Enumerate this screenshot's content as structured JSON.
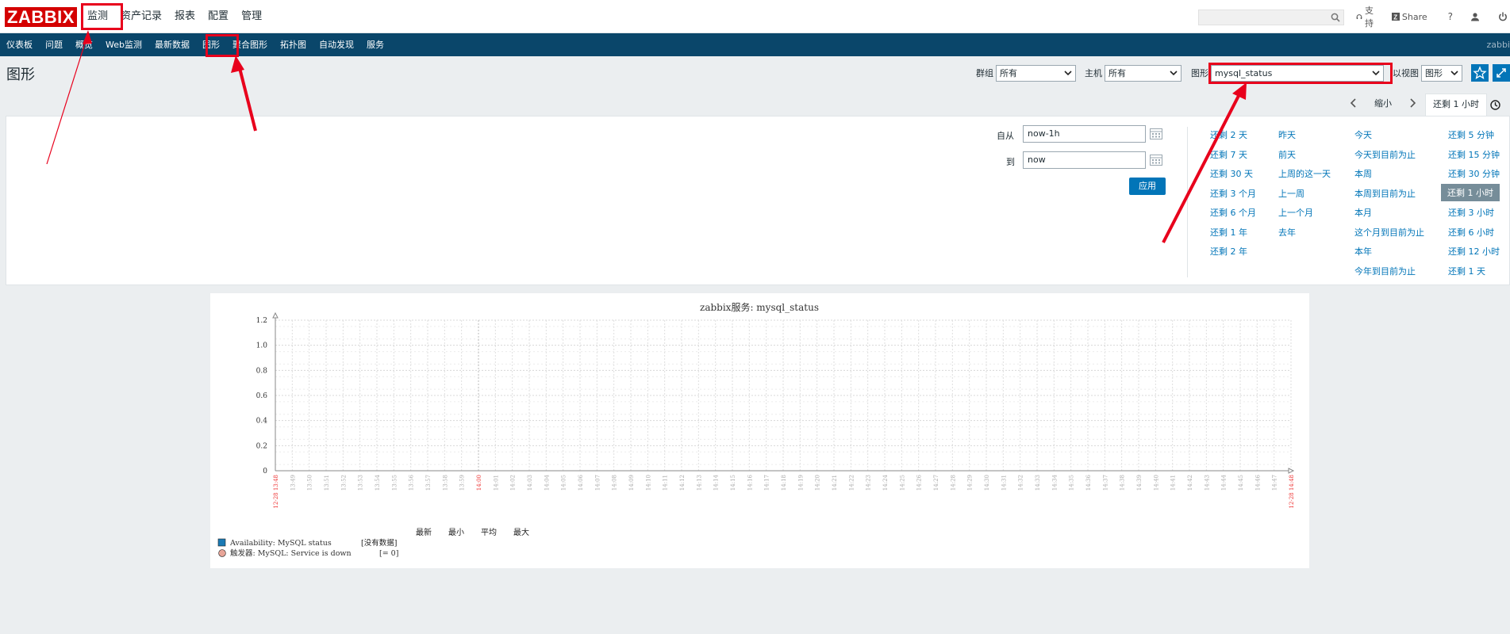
{
  "topbar": {
    "logo": "ZABBIX",
    "menu": [
      "监测",
      "资产记录",
      "报表",
      "配置",
      "管理"
    ],
    "support": "支持",
    "share": "Share",
    "help": "?"
  },
  "subnav": {
    "items": [
      "仪表板",
      "问题",
      "概览",
      "Web监测",
      "最新数据",
      "图形",
      "聚合图形",
      "拓扑图",
      "自动发现",
      "服务"
    ],
    "brand": "zabbi"
  },
  "header": {
    "title": "图形",
    "group_label": "群组",
    "group_value": "所有",
    "host_label": "主机",
    "host_value": "所有",
    "graph_label": "图形",
    "graph_value": "mysql_status",
    "view_label": "以视图",
    "view_value": "图形"
  },
  "tabs": {
    "zoom_out": "缩小",
    "active": "还剩 1 小时"
  },
  "time_filter": {
    "from_label": "自从",
    "from_value": "now-1h",
    "to_label": "到",
    "to_value": "now",
    "apply": "应用",
    "col1": [
      "还剩 2 天",
      "还剩 7 天",
      "还剩 30 天",
      "还剩 3 个月",
      "还剩 6 个月",
      "还剩 1 年",
      "还剩 2 年"
    ],
    "col2": [
      "昨天",
      "前天",
      "上周的这一天",
      "上一周",
      "上一个月",
      "去年"
    ],
    "col3": [
      "今天",
      "今天到目前为止",
      "本周",
      "本周到目前为止",
      "本月",
      "这个月到目前为止",
      "本年",
      "今年到目前为止"
    ],
    "col4": [
      "还剩 5 分钟",
      "还剩 15 分钟",
      "还剩 30 分钟",
      "还剩 1 小时",
      "还剩 3 小时",
      "还剩 6 小时",
      "还剩 12 小时",
      "还剩 1 天"
    ],
    "active_item": "还剩 1 小时"
  },
  "graph": {
    "title": "zabbix服务: mysql_status",
    "y_ticks": [
      "1.2",
      "1.0",
      "0.8",
      "0.6",
      "0.4",
      "0.2",
      "0"
    ],
    "x_start": "12-28 13:48",
    "x_end": "12-28 14:48",
    "x_mid": "14:00",
    "legend_headers": [
      "最新",
      "最小",
      "平均",
      "最大"
    ],
    "legend_item": "Availability: MySQL status",
    "legend_nodata": "[没有数据]",
    "trigger_label": "触发器: MySQL: Service is down",
    "trigger_value": "[= 0]",
    "series_color": "#1a7ab5",
    "trigger_color": "#e8a598"
  },
  "chart_data": {
    "type": "line",
    "title": "zabbix服务: mysql_status",
    "xlabel": "",
    "ylabel": "",
    "ylim": [
      0,
      1.2
    ],
    "x_range": [
      "12-28 13:48",
      "12-28 14:48"
    ],
    "series": [
      {
        "name": "Availability: MySQL status",
        "values": []
      }
    ],
    "legend_position": "bottom-left",
    "grid": true
  }
}
